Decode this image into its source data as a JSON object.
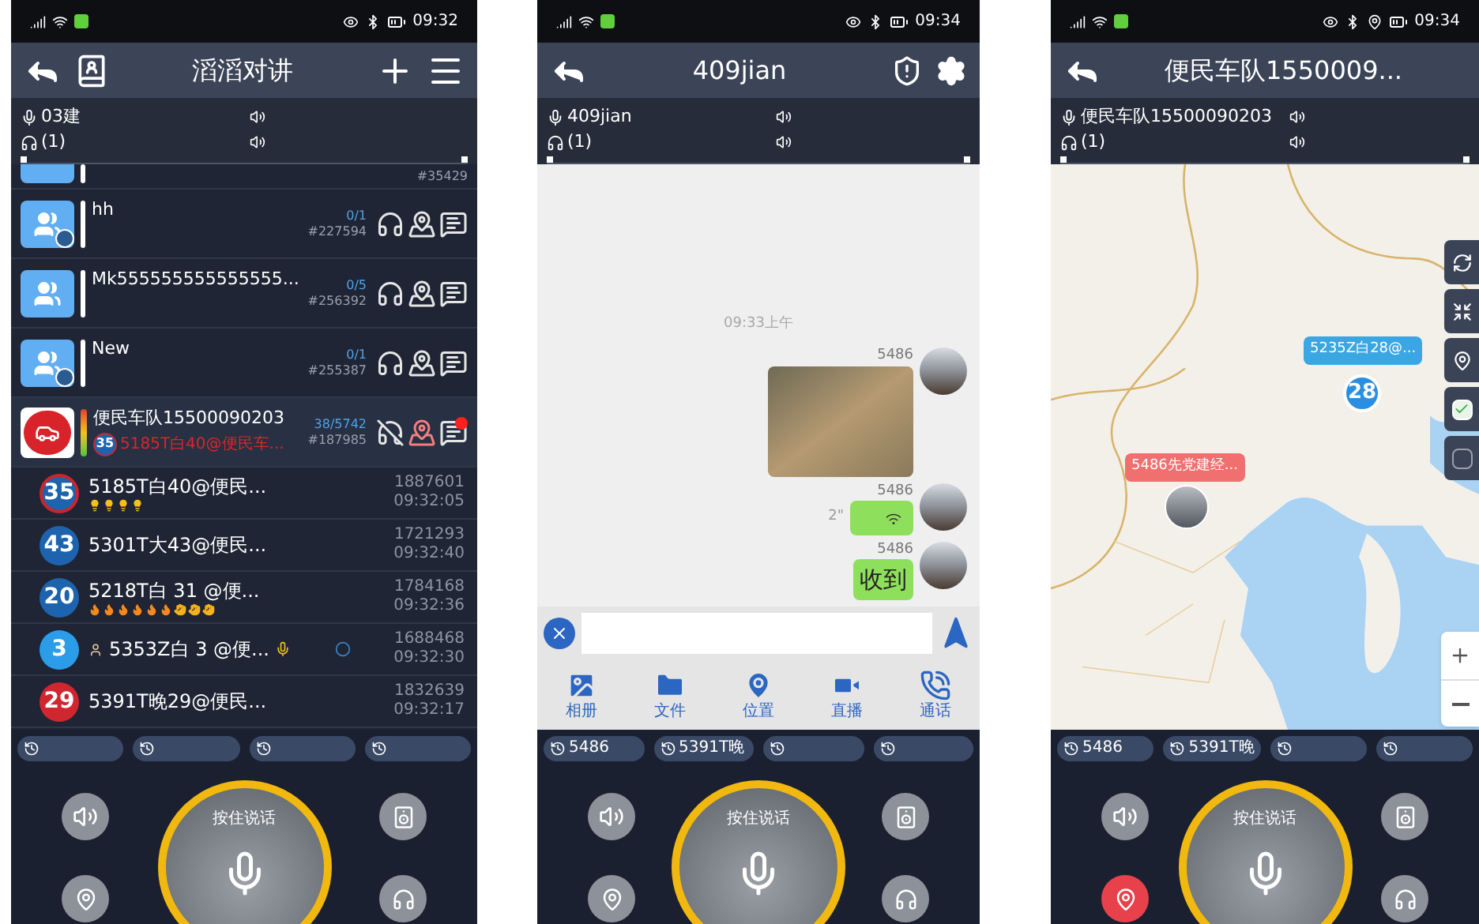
{
  "phones": [
    {
      "kind": "group_list",
      "status_time": "09:32",
      "status_location": false,
      "title": "滔滔对讲",
      "speaker": "03建",
      "listeners": "(1)",
      "groups": [
        {
          "kind": "partial",
          "number": "#35429",
          "expanded": false
        },
        {
          "kind": "group",
          "name": "hh",
          "count": "0/1",
          "number": "#227594",
          "owner": true,
          "expanded": false
        },
        {
          "kind": "group",
          "name": "Mk555555555555555...",
          "count": "0/5",
          "number": "#256392",
          "owner": false,
          "expanded": false
        },
        {
          "kind": "group",
          "name": "New",
          "count": "0/1",
          "number": "#255387",
          "owner": true,
          "expanded": false
        },
        {
          "kind": "fleet",
          "name": "便民车队15500090203",
          "count": "38/5742",
          "number": "#187985",
          "badge": "35",
          "latest": "5185T白40@便民车...",
          "unread": true,
          "expanded": true,
          "children": [
            {
              "badge": "35",
              "color": "#1e63ad",
              "ringed": true,
              "name": "5185T白40@便民...",
              "tags": [
                {
                  "kind": "bulb"
                },
                {
                  "kind": "bulb"
                },
                {
                  "kind": "bulb"
                },
                {
                  "kind": "bulb"
                }
              ],
              "talking": false,
              "id": "1887601",
              "time": "09:32:05"
            },
            {
              "badge": "43",
              "color": "#1e63ad",
              "ringed": false,
              "name": "5301T大43@便民...",
              "talking": false,
              "id": "1721293",
              "time": "09:32:40"
            },
            {
              "badge": "20",
              "color": "#1e63ad",
              "ringed": false,
              "name": "5218T白 31  @便...",
              "tags": [
                {
                  "kind": "fire"
                },
                {
                  "kind": "fire"
                },
                {
                  "kind": "fire"
                },
                {
                  "kind": "fire"
                },
                {
                  "kind": "fire"
                },
                {
                  "kind": "fire"
                },
                {
                  "kind": "pray"
                },
                {
                  "kind": "pray"
                },
                {
                  "kind": "pray"
                }
              ],
              "talking": false,
              "id": "1784168",
              "time": "09:32:36"
            },
            {
              "badge": "3",
              "color": "#2b9ce8",
              "ringed": false,
              "name": "5353Z白 3 @便...",
              "talking": true,
              "id": "1688468",
              "time": "09:32:30"
            },
            {
              "badge": "29",
              "color": "#d02630",
              "ringed": false,
              "name": "5391T晚29@便民...",
              "talking": false,
              "id": "1832639",
              "time": "09:32:17"
            }
          ]
        }
      ],
      "chips": [
        {
          "kind": "empty"
        },
        {
          "kind": "empty"
        },
        {
          "kind": "empty"
        },
        {
          "kind": "empty"
        }
      ],
      "ptt_label": "按住说话",
      "location_active": false
    },
    {
      "kind": "chat",
      "status_time": "09:34",
      "status_location": false,
      "title": "409jian",
      "speaker": "409jian",
      "listeners": "(1)",
      "time_label": "09:33上午",
      "messages": [
        {
          "kind": "image",
          "sender": "5486"
        },
        {
          "kind": "voice",
          "sender": "5486",
          "duration": "2\""
        },
        {
          "kind": "text",
          "sender": "5486",
          "text": "收到"
        }
      ],
      "tools": [
        {
          "kind": "album",
          "label": "相册"
        },
        {
          "kind": "file",
          "label": "文件"
        },
        {
          "kind": "location",
          "label": "位置"
        },
        {
          "kind": "live",
          "label": "直播"
        },
        {
          "kind": "call",
          "label": "通话"
        }
      ],
      "chips": [
        {
          "kind": "named",
          "label": "5486"
        },
        {
          "kind": "named",
          "label": "5391T晚"
        },
        {
          "kind": "empty"
        },
        {
          "kind": "empty"
        }
      ],
      "ptt_label": "按住说话",
      "location_active": false
    },
    {
      "kind": "map",
      "status_time": "09:34",
      "status_location": true,
      "title": "便民车队1550009...",
      "speaker": "便民车队15500090203",
      "listeners": "(1)",
      "markers": [
        {
          "label": "5235Z白28@...",
          "color": "#3aa6e2"
        },
        {
          "label": "5486先党建经...",
          "color": "#f06f6f"
        }
      ],
      "cluster": "28",
      "map_tools": [
        {
          "kind": "refresh"
        },
        {
          "kind": "center"
        },
        {
          "kind": "track"
        },
        {
          "kind": "checkbox",
          "checked": true
        },
        {
          "kind": "checkbox",
          "checked": false
        }
      ],
      "chips": [
        {
          "kind": "named",
          "label": "5486"
        },
        {
          "kind": "named",
          "label": "5391T晚"
        },
        {
          "kind": "empty"
        },
        {
          "kind": "empty"
        }
      ],
      "ptt_label": "按住说话",
      "location_active": true
    }
  ]
}
